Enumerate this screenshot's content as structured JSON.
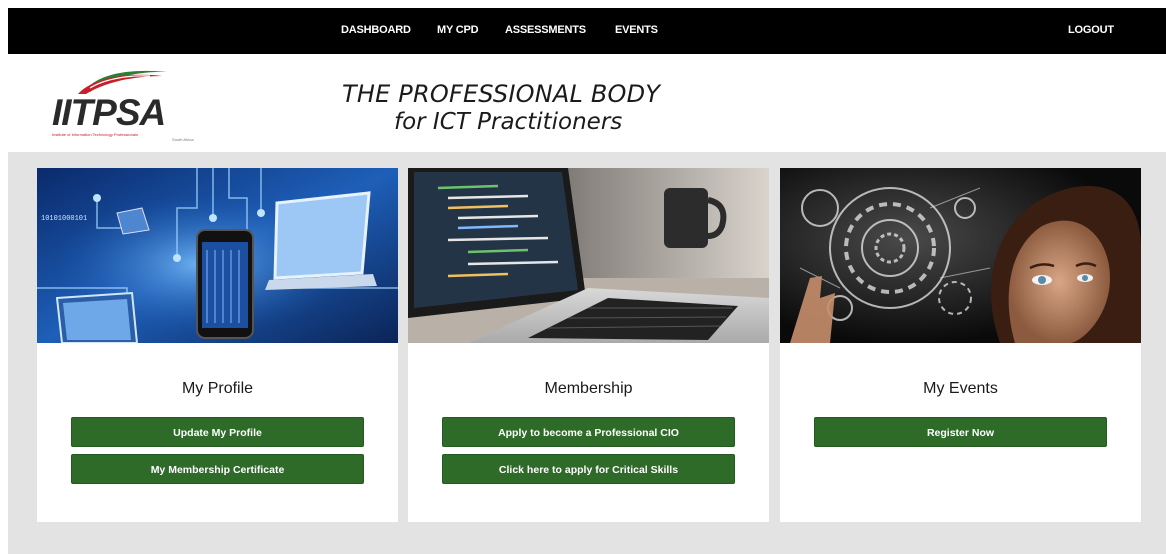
{
  "nav": {
    "links": [
      "DASHBOARD",
      "MY CPD",
      "ASSESSMENTS",
      "EVENTS"
    ],
    "logout": "LOGOUT"
  },
  "header": {
    "logo_text": "IITPSA",
    "logo_subtitle": "Institute of Information Technology Professionals",
    "logo_country": "South Africa",
    "tagline_line1": "THE PROFESSIONAL BODY",
    "tagline_line2": "for ICT Practitioners"
  },
  "cards": [
    {
      "title": "My Profile",
      "buttons": [
        "Update My Profile",
        "My Membership Certificate"
      ],
      "image_text": "10101000101"
    },
    {
      "title": "Membership",
      "buttons": [
        "Apply to become a Professional CIO",
        "Click here to apply for Critical Skills"
      ]
    },
    {
      "title": "My Events",
      "buttons": [
        "Register Now"
      ]
    }
  ],
  "colors": {
    "topbar": "#000000",
    "button": "#2e6b29",
    "background": "#e3e3e3",
    "logo_red": "#c8202a",
    "logo_green": "#2e7d32"
  }
}
